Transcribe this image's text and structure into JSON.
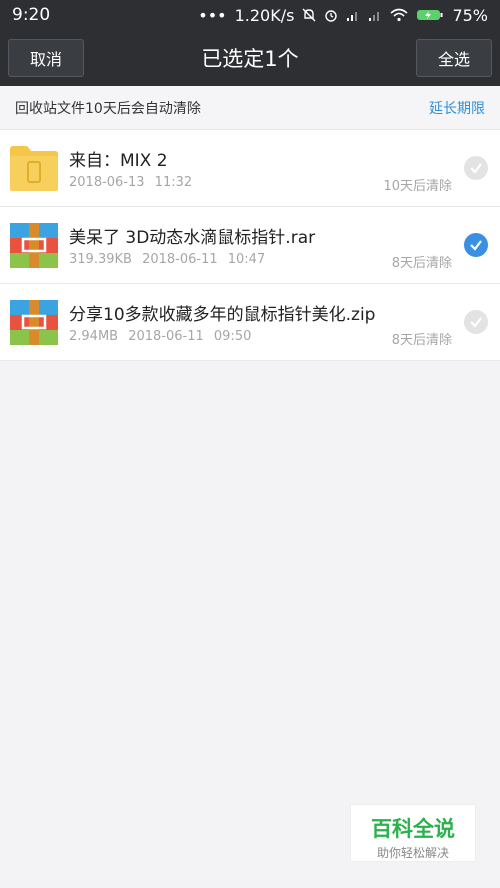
{
  "status_bar": {
    "time": "9:20",
    "dots": "•••",
    "speed": "1.20K/s",
    "battery": "75%"
  },
  "header": {
    "cancel_label": "取消",
    "title": "已选定1个",
    "select_all_label": "全选"
  },
  "notice": {
    "text": "回收站文件10天后会自动清除",
    "action": "延长期限"
  },
  "files": [
    {
      "name": "来自：MIX 2",
      "meta": "2018-06-13 11:32",
      "expire": "10天后清除",
      "icon": "folder-icon",
      "selected": false
    },
    {
      "name": "美呆了 3D动态水滴鼠标指针.rar",
      "meta": "319.39KB 2018-06-11 10:47",
      "expire": "8天后清除",
      "icon": "archive-icon",
      "selected": true
    },
    {
      "name": "分享10多款收藏多年的鼠标指针美化.zip",
      "meta": "2.94MB 2018-06-11 09:50",
      "expire": "8天后清除",
      "icon": "archive-icon",
      "selected": false
    }
  ],
  "watermark": {
    "title": "百科全说",
    "subtitle": "助你轻松解决"
  },
  "colors": {
    "header_bg": "#2d2f33",
    "accent": "#3a8fe2",
    "folder": "#f5c648",
    "watermark_green": "#2bb24c"
  }
}
